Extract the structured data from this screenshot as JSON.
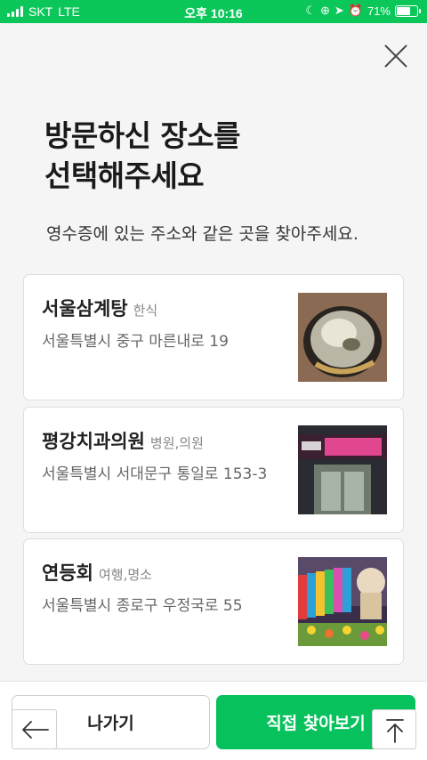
{
  "status_bar": {
    "carrier": "SKT",
    "network": "LTE",
    "time": "오후 10:16",
    "battery": "71%",
    "battery_level": 0.71
  },
  "header": {
    "title": "방문하신 장소를\n선택해주세요",
    "subtitle": "영수증에 있는 주소와 같은 곳을 찾아주세요."
  },
  "places": [
    {
      "name": "서울삼계탕",
      "category": "한식",
      "address": "서울특별시 중구 마른내로 19"
    },
    {
      "name": "평강치과의원",
      "category": "병원,의원",
      "address": "서울특별시 서대문구 통일로 153-3"
    },
    {
      "name": "연등회",
      "category": "여행,명소",
      "address": "서울특별시 종로구 우정국로 55"
    }
  ],
  "bottom": {
    "exit_label": "나가기",
    "direct_label": "직접 찾아보기"
  },
  "colors": {
    "accent": "#07c15c",
    "status_bar": "#0bc75a"
  },
  "icons": {
    "close": "close-icon",
    "back": "arrow-left-icon",
    "scroll_top": "arrow-up-to-top-icon"
  }
}
